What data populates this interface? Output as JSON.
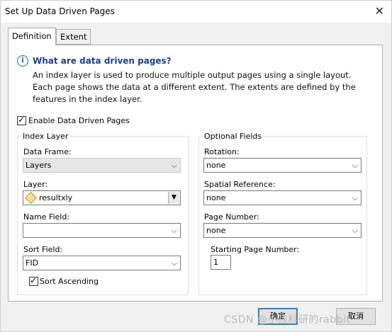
{
  "window": {
    "title": "Set Up Data Driven Pages",
    "close_glyph": "✕"
  },
  "tabs": [
    {
      "label": "Definition",
      "active": true
    },
    {
      "label": "Extent",
      "active": false
    }
  ],
  "info": {
    "icon": "info-icon",
    "title": "What are data driven pages?",
    "lines": [
      "An index layer is used to produce multiple output pages using a single layout.",
      "Each page shows the data at a different extent.  The extents are defined by the",
      "features in the index layer."
    ]
  },
  "enable_ddp": {
    "label": "Enable Data Driven Pages",
    "checked": true
  },
  "index_layer": {
    "title": "Index Layer",
    "data_frame": {
      "label": "Data Frame:",
      "value": "Layers"
    },
    "layer": {
      "label": "Layer:",
      "value": "resultxly",
      "icon": "polygon-layer-icon"
    },
    "name_field": {
      "label": "Name Field:",
      "value": ""
    },
    "sort_field": {
      "label": "Sort Field:",
      "value": "FID"
    },
    "sort_ascending": {
      "label": "Sort Ascending",
      "checked": true
    }
  },
  "optional_fields": {
    "title": "Optional Fields",
    "rotation": {
      "label": "Rotation:",
      "value": "none"
    },
    "spatial_reference": {
      "label": "Spatial Reference:",
      "value": "none"
    },
    "page_number": {
      "label": "Page Number:",
      "value": "none"
    },
    "starting_page_number": {
      "label": "Starting Page Number:",
      "value": "1"
    }
  },
  "buttons": {
    "ok": "确定",
    "cancel": "取消"
  },
  "watermark": "CSDN @小孩科研的rabbit",
  "colors": {
    "info_title": "#1f3f8a",
    "info_icon": "#1f64b4",
    "default_button_border": "#3c7fb1"
  }
}
